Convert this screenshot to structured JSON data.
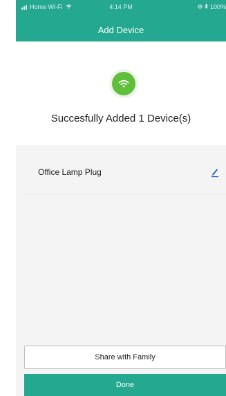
{
  "status_bar": {
    "carrier": "Home Wi-Fi",
    "time": "4:14 PM",
    "battery": "100%"
  },
  "header": {
    "title": "Add Device"
  },
  "success": {
    "icon": "wifi-icon",
    "message": "Succesfully Added 1 Device(s)"
  },
  "devices": [
    {
      "name": "Office Lamp Plug",
      "action_icon": "edit-pencil-icon"
    }
  ],
  "actions": {
    "share_label": "Share with Family",
    "done_label": "Done"
  },
  "colors": {
    "header": "#24a88f",
    "success_icon": "#5fbf3a",
    "edit_icon": "#2d63c4",
    "background": "#f4f4f4"
  }
}
